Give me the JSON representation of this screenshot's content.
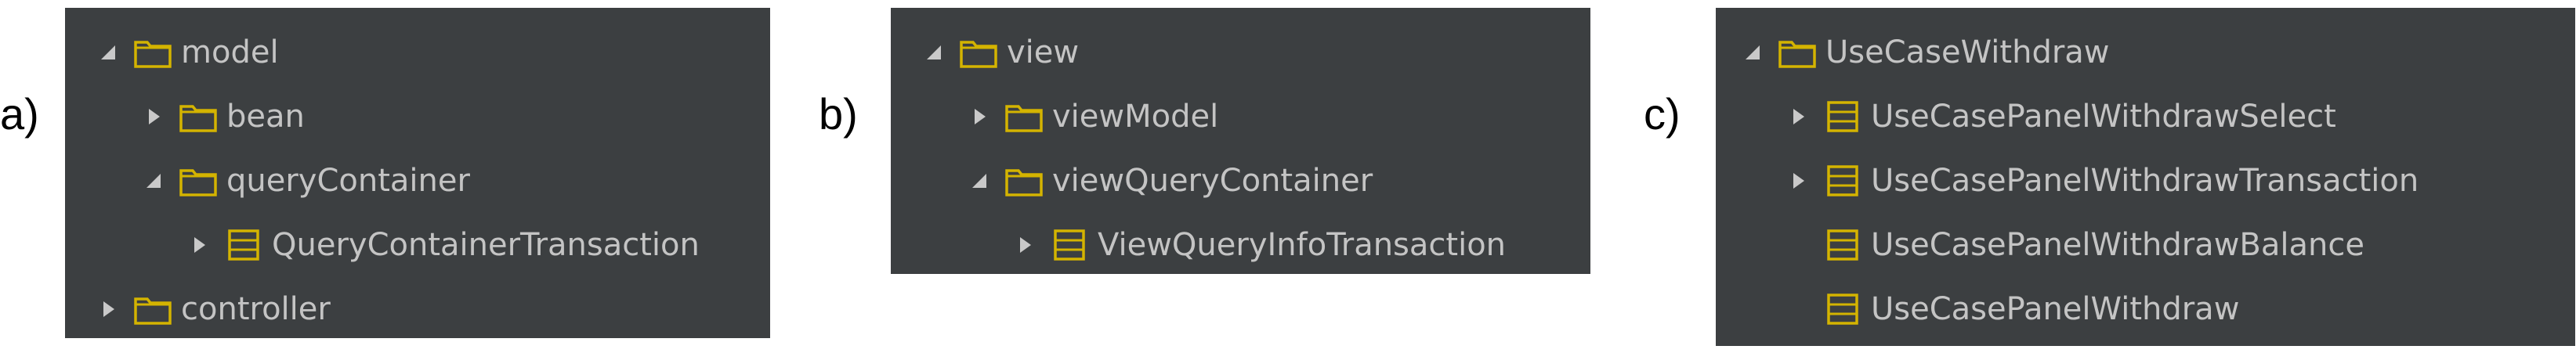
{
  "labels": {
    "a": "a)",
    "b": "b)",
    "c": "c)"
  },
  "colors": {
    "panel_bg": "#3c3f41",
    "text": "#c4c4c4",
    "arrow": "#c9c9c9",
    "icon": "#d4b400"
  },
  "panel_a": {
    "items": [
      {
        "label": "model",
        "arrow": "expanded",
        "icon": "folder-icon"
      },
      {
        "label": "bean",
        "arrow": "collapsed",
        "icon": "folder-icon"
      },
      {
        "label": "queryContainer",
        "arrow": "expanded",
        "icon": "folder-icon"
      },
      {
        "label": "QueryContainerTransaction",
        "arrow": "collapsed",
        "icon": "class-icon"
      },
      {
        "label": "controller",
        "arrow": "collapsed",
        "icon": "folder-icon"
      }
    ]
  },
  "panel_b": {
    "items": [
      {
        "label": "view",
        "arrow": "expanded",
        "icon": "folder-icon"
      },
      {
        "label": "viewModel",
        "arrow": "collapsed",
        "icon": "folder-icon"
      },
      {
        "label": "viewQueryContainer",
        "arrow": "expanded",
        "icon": "folder-icon"
      },
      {
        "label": "ViewQueryInfoTransaction",
        "arrow": "collapsed",
        "icon": "class-icon"
      }
    ]
  },
  "panel_c": {
    "items": [
      {
        "label": "UseCaseWithdraw",
        "arrow": "expanded",
        "icon": "folder-icon"
      },
      {
        "label": "UseCasePanelWithdrawSelect",
        "arrow": "collapsed",
        "icon": "class-icon"
      },
      {
        "label": "UseCasePanelWithdrawTransaction",
        "arrow": "collapsed",
        "icon": "class-icon"
      },
      {
        "label": "UseCasePanelWithdrawBalance",
        "arrow": "none",
        "icon": "class-icon"
      },
      {
        "label": "UseCasePanelWithdraw",
        "arrow": "none",
        "icon": "class-icon"
      }
    ]
  }
}
